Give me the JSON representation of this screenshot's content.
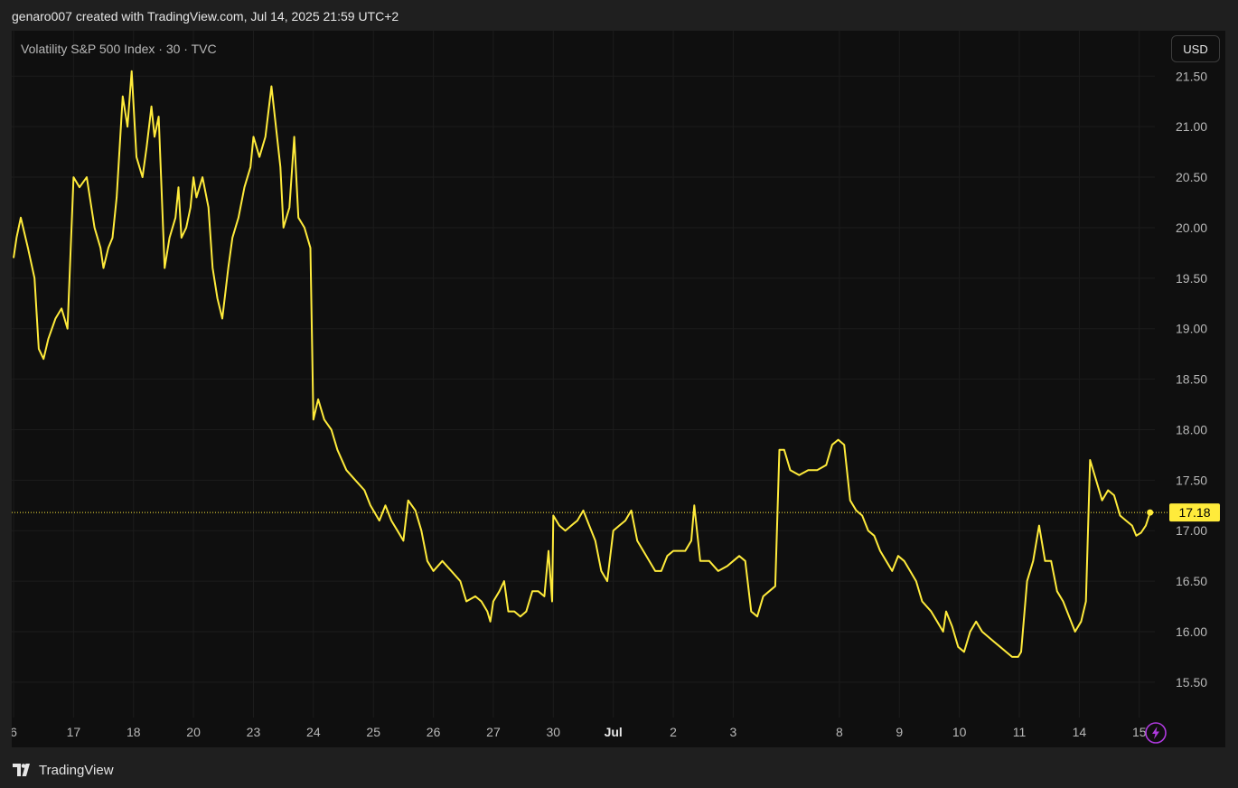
{
  "header": {
    "text": "genaro007 created with TradingView.com, Jul 14, 2025 21:59 UTC+2"
  },
  "chart": {
    "symbol_title": "Volatility S&P 500 Index · 30 · TVC",
    "currency": "USD",
    "last_price_label": "17.18"
  },
  "footer": {
    "brand": "TradingView"
  },
  "colors": {
    "line": "#ffeb3b",
    "background": "#0f0f0f",
    "grid": "#1c1c1c",
    "axis_text": "#b8b8b8",
    "badge_bg": "#ffeb3b",
    "badge_text": "#000000",
    "bolt": "#b03ae0"
  },
  "chart_data": {
    "type": "line",
    "title": "",
    "xlabel": "",
    "ylabel": "",
    "ylim": [
      15.15,
      21.95
    ],
    "grid": true,
    "last_price": 17.18,
    "y_ticks": [
      "21.50",
      "21.00",
      "20.50",
      "20.00",
      "19.50",
      "19.00",
      "18.50",
      "18.00",
      "17.50",
      "17.00",
      "16.50",
      "16.00",
      "15.50"
    ],
    "x_ticks": [
      "6",
      "17",
      "18",
      "20",
      "23",
      "24",
      "25",
      "26",
      "27",
      "30",
      "Jul",
      "2",
      "3",
      "8",
      "9",
      "10",
      "11",
      "14",
      "15"
    ],
    "session_index": [
      0,
      1,
      2,
      3,
      4,
      5,
      6,
      7,
      8,
      9,
      10,
      11,
      12,
      13.77,
      14.77,
      15.77,
      16.77,
      17.77,
      18.77
    ],
    "x_span": [
      -0.03,
      19.03
    ],
    "series": [
      {
        "values": [
          [
            0.0,
            19.7
          ],
          [
            0.05,
            19.9
          ],
          [
            0.12,
            20.1
          ],
          [
            0.24,
            19.8
          ],
          [
            0.35,
            19.5
          ],
          [
            0.42,
            18.8
          ],
          [
            0.5,
            18.7
          ],
          [
            0.58,
            18.9
          ],
          [
            0.7,
            19.1
          ],
          [
            0.8,
            19.2
          ],
          [
            0.9,
            19.0
          ],
          [
            1.0,
            20.5
          ],
          [
            1.1,
            20.4
          ],
          [
            1.22,
            20.5
          ],
          [
            1.35,
            20.0
          ],
          [
            1.45,
            19.8
          ],
          [
            1.5,
            19.6
          ],
          [
            1.58,
            19.8
          ],
          [
            1.65,
            19.9
          ],
          [
            1.72,
            20.3
          ],
          [
            1.82,
            21.3
          ],
          [
            1.9,
            21.0
          ],
          [
            1.97,
            21.55
          ],
          [
            2.05,
            20.7
          ],
          [
            2.15,
            20.5
          ],
          [
            2.22,
            20.8
          ],
          [
            2.3,
            21.2
          ],
          [
            2.35,
            20.9
          ],
          [
            2.42,
            21.1
          ],
          [
            2.52,
            19.6
          ],
          [
            2.6,
            19.9
          ],
          [
            2.7,
            20.1
          ],
          [
            2.75,
            20.4
          ],
          [
            2.8,
            19.9
          ],
          [
            2.88,
            20.0
          ],
          [
            2.95,
            20.2
          ],
          [
            3.0,
            20.5
          ],
          [
            3.05,
            20.3
          ],
          [
            3.15,
            20.5
          ],
          [
            3.25,
            20.2
          ],
          [
            3.32,
            19.6
          ],
          [
            3.4,
            19.3
          ],
          [
            3.48,
            19.1
          ],
          [
            3.58,
            19.6
          ],
          [
            3.65,
            19.9
          ],
          [
            3.75,
            20.1
          ],
          [
            3.85,
            20.4
          ],
          [
            3.95,
            20.6
          ],
          [
            4.0,
            20.9
          ],
          [
            4.1,
            20.7
          ],
          [
            4.2,
            20.9
          ],
          [
            4.3,
            21.4
          ],
          [
            4.45,
            20.6
          ],
          [
            4.5,
            20.0
          ],
          [
            4.6,
            20.2
          ],
          [
            4.68,
            20.9
          ],
          [
            4.75,
            20.1
          ],
          [
            4.85,
            20.0
          ],
          [
            4.95,
            19.8
          ],
          [
            5.0,
            18.1
          ],
          [
            5.08,
            18.3
          ],
          [
            5.18,
            18.1
          ],
          [
            5.3,
            18.0
          ],
          [
            5.4,
            17.8
          ],
          [
            5.55,
            17.6
          ],
          [
            5.7,
            17.5
          ],
          [
            5.85,
            17.4
          ],
          [
            5.95,
            17.25
          ],
          [
            6.0,
            17.2
          ],
          [
            6.1,
            17.1
          ],
          [
            6.2,
            17.25
          ],
          [
            6.3,
            17.1
          ],
          [
            6.4,
            17.0
          ],
          [
            6.5,
            16.9
          ],
          [
            6.58,
            17.3
          ],
          [
            6.7,
            17.2
          ],
          [
            6.8,
            17.0
          ],
          [
            6.9,
            16.7
          ],
          [
            7.0,
            16.6
          ],
          [
            7.15,
            16.7
          ],
          [
            7.3,
            16.6
          ],
          [
            7.45,
            16.5
          ],
          [
            7.55,
            16.3
          ],
          [
            7.7,
            16.35
          ],
          [
            7.8,
            16.3
          ],
          [
            7.9,
            16.2
          ],
          [
            7.95,
            16.1
          ],
          [
            8.0,
            16.3
          ],
          [
            8.1,
            16.4
          ],
          [
            8.18,
            16.5
          ],
          [
            8.25,
            16.2
          ],
          [
            8.35,
            16.2
          ],
          [
            8.45,
            16.15
          ],
          [
            8.55,
            16.2
          ],
          [
            8.65,
            16.4
          ],
          [
            8.75,
            16.4
          ],
          [
            8.85,
            16.35
          ],
          [
            8.92,
            16.8
          ],
          [
            8.98,
            16.3
          ],
          [
            9.0,
            17.15
          ],
          [
            9.1,
            17.05
          ],
          [
            9.2,
            17.0
          ],
          [
            9.3,
            17.05
          ],
          [
            9.4,
            17.1
          ],
          [
            9.5,
            17.2
          ],
          [
            9.6,
            17.05
          ],
          [
            9.7,
            16.9
          ],
          [
            9.8,
            16.6
          ],
          [
            9.9,
            16.5
          ],
          [
            10.0,
            17.0
          ],
          [
            10.1,
            17.05
          ],
          [
            10.2,
            17.1
          ],
          [
            10.3,
            17.2
          ],
          [
            10.4,
            16.9
          ],
          [
            10.5,
            16.8
          ],
          [
            10.6,
            16.7
          ],
          [
            10.7,
            16.6
          ],
          [
            10.8,
            16.6
          ],
          [
            10.9,
            16.75
          ],
          [
            11.0,
            16.8
          ],
          [
            11.1,
            16.8
          ],
          [
            11.2,
            16.8
          ],
          [
            11.3,
            16.9
          ],
          [
            11.35,
            17.25
          ],
          [
            11.45,
            16.7
          ],
          [
            11.6,
            16.7
          ],
          [
            11.75,
            16.6
          ],
          [
            11.9,
            16.65
          ],
          [
            12.0,
            16.7
          ],
          [
            12.1,
            16.75
          ],
          [
            12.2,
            16.7
          ],
          [
            12.3,
            16.2
          ],
          [
            12.4,
            16.15
          ],
          [
            12.5,
            16.35
          ],
          [
            12.6,
            16.4
          ],
          [
            12.7,
            16.45
          ],
          [
            12.77,
            17.8
          ],
          [
            12.85,
            17.8
          ],
          [
            12.95,
            17.6
          ],
          [
            13.1,
            17.55
          ],
          [
            13.25,
            17.6
          ],
          [
            13.4,
            17.6
          ],
          [
            13.55,
            17.65
          ],
          [
            13.65,
            17.85
          ],
          [
            13.75,
            17.9
          ],
          [
            13.85,
            17.85
          ],
          [
            13.95,
            17.3
          ],
          [
            14.05,
            17.2
          ],
          [
            14.15,
            17.15
          ],
          [
            14.25,
            17.0
          ],
          [
            14.35,
            16.95
          ],
          [
            14.45,
            16.8
          ],
          [
            14.55,
            16.7
          ],
          [
            14.65,
            16.6
          ],
          [
            14.75,
            16.75
          ],
          [
            14.85,
            16.7
          ],
          [
            14.95,
            16.6
          ],
          [
            15.05,
            16.5
          ],
          [
            15.15,
            16.3
          ],
          [
            15.3,
            16.2
          ],
          [
            15.4,
            16.1
          ],
          [
            15.5,
            16.0
          ],
          [
            15.55,
            16.2
          ],
          [
            15.65,
            16.05
          ],
          [
            15.75,
            15.85
          ],
          [
            15.85,
            15.8
          ],
          [
            15.95,
            16.0
          ],
          [
            16.05,
            16.1
          ],
          [
            16.15,
            16.0
          ],
          [
            16.25,
            15.95
          ],
          [
            16.35,
            15.9
          ],
          [
            16.45,
            15.85
          ],
          [
            16.55,
            15.8
          ],
          [
            16.65,
            15.75
          ],
          [
            16.75,
            15.75
          ],
          [
            16.8,
            15.8
          ],
          [
            16.9,
            16.5
          ],
          [
            17.0,
            16.7
          ],
          [
            17.1,
            17.05
          ],
          [
            17.2,
            16.7
          ],
          [
            17.3,
            16.7
          ],
          [
            17.4,
            16.4
          ],
          [
            17.5,
            16.3
          ],
          [
            17.6,
            16.15
          ],
          [
            17.7,
            16.0
          ],
          [
            17.8,
            16.1
          ],
          [
            17.88,
            16.3
          ],
          [
            17.95,
            17.7
          ],
          [
            18.05,
            17.5
          ],
          [
            18.15,
            17.3
          ],
          [
            18.25,
            17.4
          ],
          [
            18.35,
            17.35
          ],
          [
            18.45,
            17.15
          ],
          [
            18.55,
            17.1
          ],
          [
            18.65,
            17.05
          ],
          [
            18.72,
            16.95
          ],
          [
            18.8,
            16.98
          ],
          [
            18.88,
            17.05
          ],
          [
            18.95,
            17.18
          ]
        ]
      }
    ]
  }
}
